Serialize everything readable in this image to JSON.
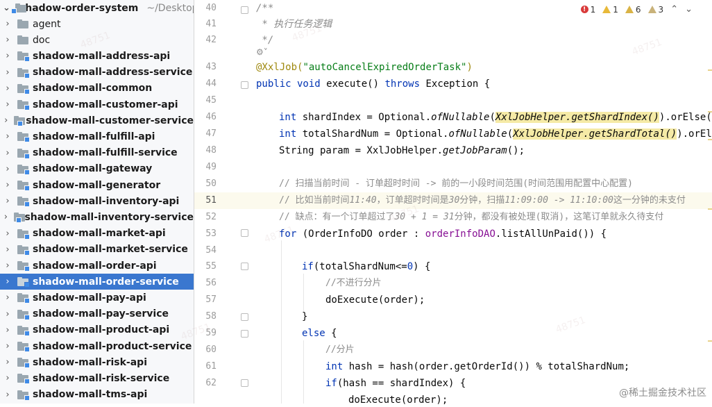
{
  "project": {
    "root_name": "shadow-order-system",
    "root_path": "~/Desktop"
  },
  "tree": [
    {
      "label": "agent",
      "selected": false
    },
    {
      "label": "doc",
      "selected": false
    },
    {
      "label": "shadow-mall-address-api",
      "selected": false
    },
    {
      "label": "shadow-mall-address-service",
      "selected": false
    },
    {
      "label": "shadow-mall-common",
      "selected": false
    },
    {
      "label": "shadow-mall-customer-api",
      "selected": false
    },
    {
      "label": "shadow-mall-customer-service",
      "selected": false
    },
    {
      "label": "shadow-mall-fulfill-api",
      "selected": false
    },
    {
      "label": "shadow-mall-fulfill-service",
      "selected": false
    },
    {
      "label": "shadow-mall-gateway",
      "selected": false
    },
    {
      "label": "shadow-mall-generator",
      "selected": false
    },
    {
      "label": "shadow-mall-inventory-api",
      "selected": false
    },
    {
      "label": "shadow-mall-inventory-service",
      "selected": false
    },
    {
      "label": "shadow-mall-market-api",
      "selected": false
    },
    {
      "label": "shadow-mall-market-service",
      "selected": false
    },
    {
      "label": "shadow-mall-order-api",
      "selected": false
    },
    {
      "label": "shadow-mall-order-service",
      "selected": true
    },
    {
      "label": "shadow-mall-pay-api",
      "selected": false
    },
    {
      "label": "shadow-mall-pay-service",
      "selected": false
    },
    {
      "label": "shadow-mall-product-api",
      "selected": false
    },
    {
      "label": "shadow-mall-product-service",
      "selected": false
    },
    {
      "label": "shadow-mall-risk-api",
      "selected": false
    },
    {
      "label": "shadow-mall-risk-service",
      "selected": false
    },
    {
      "label": "shadow-mall-tms-api",
      "selected": false
    }
  ],
  "inspections": {
    "errors": "1",
    "warnings_a": "1",
    "warnings_b": "6",
    "warnings_c": "3"
  },
  "line_numbers": [
    "40",
    "41",
    "42",
    "43",
    "44",
    "45",
    "46",
    "47",
    "48",
    "49",
    "50",
    "51",
    "52",
    "53",
    "54",
    "55",
    "56",
    "57",
    "58",
    "59",
    "60",
    "61",
    "62"
  ],
  "render_hint": "⚙˅",
  "code": {
    "l40": "/**",
    "l41": " * 执行任务逻辑",
    "l42": " */",
    "l43_ann": "@XxlJob(",
    "l43_str": "\"autoCancelExpiredOrderTask\"",
    "l43_end": ")",
    "l44_kw1": "public void ",
    "l44_name": "execute() ",
    "l44_kw2": "throws ",
    "l44_exc": "Exception {",
    "l46_kw": "int ",
    "l46_a": "shardIndex = Optional.",
    "l46_b": "ofNullable",
    "l46_c": "(",
    "l46_hl": "XxlJobHelper.getShardIndex()",
    "l46_d": ").orElse(",
    "l47_kw": "int ",
    "l47_a": "totalShardNum = Optional.",
    "l47_b": "ofNullable",
    "l47_c": "(",
    "l47_hl": "XxlJobHelper.getShardTotal()",
    "l47_d": ").orEls",
    "l48_a": "String param = XxlJobHelper.",
    "l48_b": "getJobParam",
    "l48_c": "();",
    "l50": "// 扫描当前时间 - 订单超时时间 -> 前的一小段时间范围(时间范围用配置中心配置)",
    "l51_a": "// 比如当前时间",
    "l51_b": "11:40",
    "l51_c": "，订单超时时间是",
    "l51_d": "30",
    "l51_e": "分钟，扫描",
    "l51_f": "11:09:00 -> 11:10:00",
    "l51_g": "这一分钟的未支付",
    "l52_a": "// 缺点：有一个订单超过了",
    "l52_b": "30 + 1 = 31",
    "l52_c": "分钟，都没有被处理(取消)，这笔订单就永久待支付",
    "l53_kw": "for ",
    "l53_a": "(OrderInfoDO order : ",
    "l53_fld": "orderInfoDAO",
    "l53_b": ".listAllUnPaid()) {",
    "l55_kw": "if",
    "l55_a": "(totalShardNum<=",
    "l55_num": "0",
    "l55_b": ") {",
    "l56": "//不进行分片",
    "l57": "doExecute(order);",
    "l58": "}",
    "l59_kw": "else ",
    "l59_a": "{",
    "l60": "//分片",
    "l61_kw": "int ",
    "l61_a": "hash = hash(order.getOrderId()) % totalShardNum;",
    "l62_kw": "if",
    "l62_a": "(hash == shardIndex) {",
    "l63": "doExecute(order);"
  },
  "credit": "@稀土掘金技术社区"
}
